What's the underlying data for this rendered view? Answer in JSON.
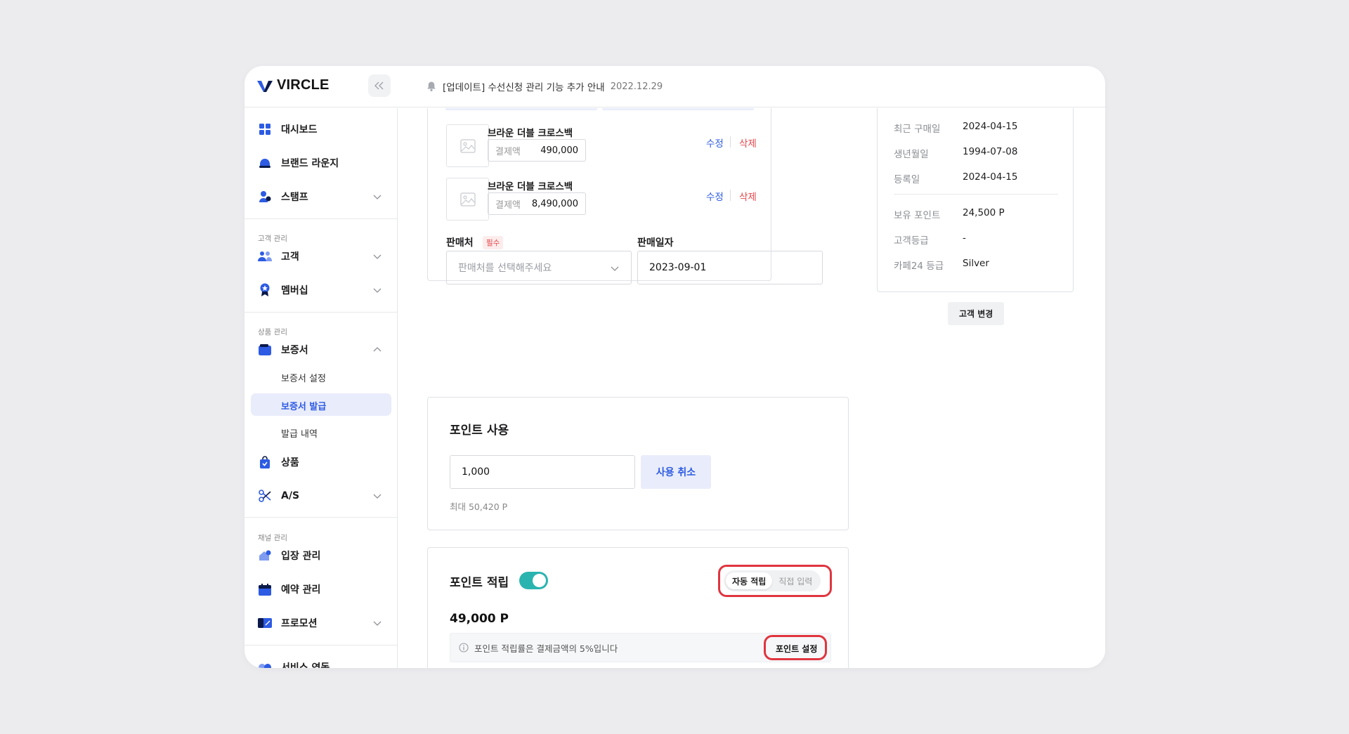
{
  "header": {
    "logo_text": "VIRCLE",
    "notice_text": "[업데이트] 수선신청 관리 기능 추가 안내",
    "notice_date": "2022.12.29"
  },
  "sidebar": {
    "dashboard": "대시보드",
    "brand_lounge": "브랜드 라운지",
    "stamp": "스탬프",
    "section_customer": "고객 관리",
    "customer": "고객",
    "membership": "멤버십",
    "section_product": "상품 관리",
    "warranty": "보증서",
    "warranty_settings": "보증서 설정",
    "warranty_issue": "보증서 발급",
    "issue_history": "발급 내역",
    "product": "상품",
    "as": "A/S",
    "section_channel": "채널 관리",
    "entrance": "입장 관리",
    "reservation": "예약 관리",
    "promotion": "프로모션",
    "service_link": "서비스 연동"
  },
  "products": [
    {
      "name": "브라운 더블 크로스백",
      "price_label": "결제액",
      "price": "490,000",
      "edit": "수정",
      "delete": "삭제"
    },
    {
      "name": "브라운 더블 크로스백",
      "price_label": "결제액",
      "price": "8,490,000",
      "edit": "수정",
      "delete": "삭제"
    }
  ],
  "sale": {
    "seller_label": "판매처",
    "required_badge": "필수",
    "seller_placeholder": "판매처를 선택해주세요",
    "date_label": "판매일자",
    "date_value": "2023-09-01"
  },
  "point_use": {
    "title": "포인트 사용",
    "input_value": "1,000",
    "cancel_button": "사용 취소",
    "max_hint": "최대 50,420 P"
  },
  "point_earn": {
    "title": "포인트 적립",
    "toggle_on": true,
    "auto_option": "자동 적립",
    "manual_option": "직접 입력",
    "amount": "49,000 P",
    "info_text": "포인트 적립률은 결제금액의 5%입니다",
    "settings_button": "포인트 설정"
  },
  "customer_info": {
    "rows": [
      {
        "key": "최근 구매일",
        "value": "2024-04-15"
      },
      {
        "key": "생년월일",
        "value": "1994-07-08"
      },
      {
        "key": "등록일",
        "value": "2024-04-15"
      },
      {
        "key": "보유 포인트",
        "value": "24,500 P"
      },
      {
        "key": "고객등급",
        "value": "-"
      },
      {
        "key": "카페24 등급",
        "value": "Silver"
      }
    ],
    "change_button": "고객 변경"
  },
  "colors": {
    "accent_blue": "#2d5be3",
    "delete_red": "#e5484d",
    "toggle_teal": "#2ab4b0",
    "highlight_red": "#e0353f"
  }
}
